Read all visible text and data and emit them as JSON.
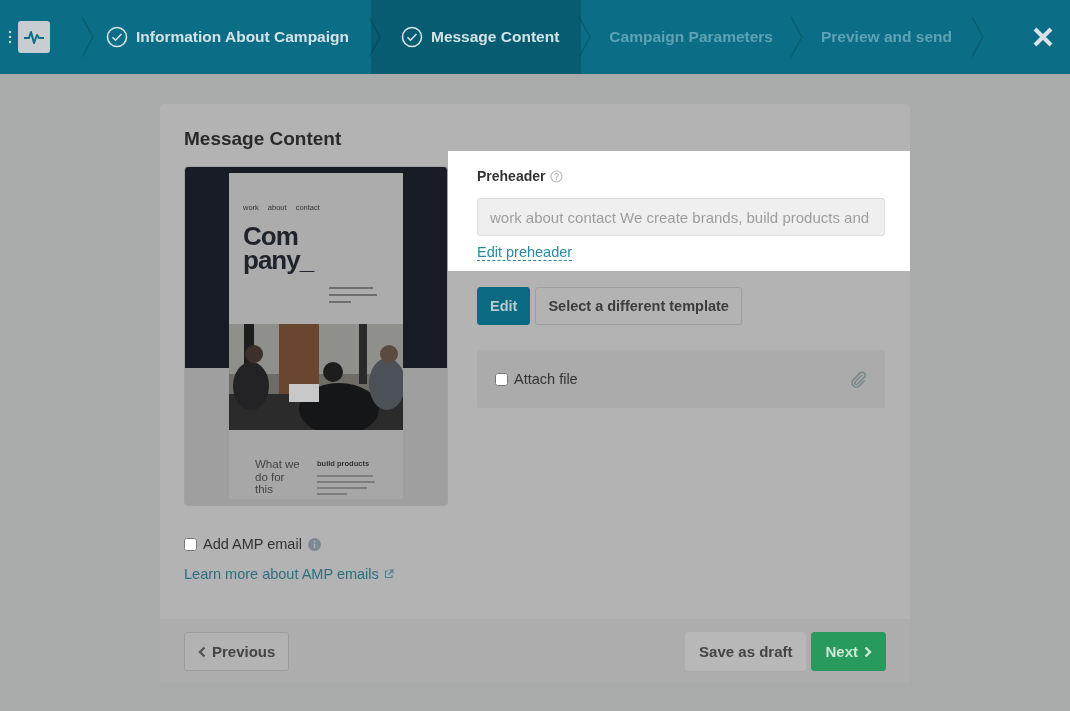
{
  "steps": [
    {
      "label": "Information About Campaign",
      "completed": true,
      "selected": false
    },
    {
      "label": "Message Content",
      "completed": true,
      "selected": true
    },
    {
      "label": "Campaign Parameters",
      "completed": false,
      "selected": false
    },
    {
      "label": "Preview and send",
      "completed": false,
      "selected": false
    }
  ],
  "section_title": "Message Content",
  "template_preview": {
    "nav": [
      "work",
      "about",
      "contact"
    ],
    "headline": [
      "Com",
      "pany_"
    ],
    "heading": "What we do for this",
    "subheading": "build products"
  },
  "preheader": {
    "label": "Preheader",
    "value": "work about contact We create brands, build products and",
    "spotlight": true,
    "link": "Edit preheader"
  },
  "buttons": [
    {
      "label": "Edit",
      "kind": "primary"
    },
    {
      "label": "Select a different template",
      "kind": "secondary"
    }
  ],
  "attach": {
    "label": "Attach file",
    "checked": false
  },
  "amp": {
    "label": "Add AMP email",
    "checked": false,
    "link": "Learn more about AMP emails"
  },
  "footer": {
    "previous": "Previous",
    "save": "Save as draft",
    "next": "Next"
  }
}
